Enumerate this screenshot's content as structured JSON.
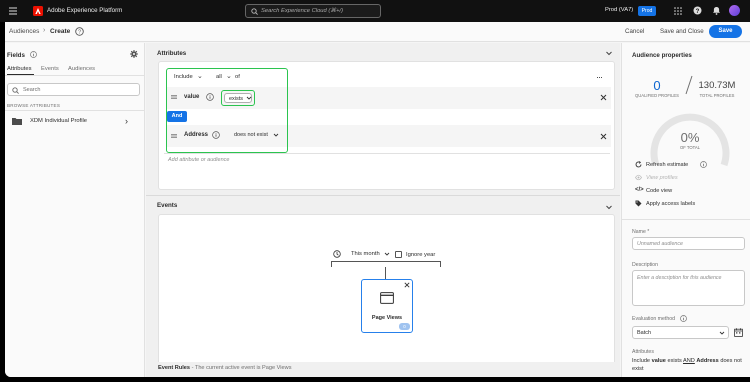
{
  "topbar": {
    "product": "Adobe Experience Platform",
    "search_placeholder": "Search Experience Cloud (⌘+/)",
    "org": "Prod (VA7)",
    "env_badge": "Prod"
  },
  "header": {
    "breadcrumb_parent": "Audiences",
    "breadcrumb_current": "Create",
    "cancel": "Cancel",
    "save_close": "Save and Close",
    "save": "Save"
  },
  "fields": {
    "title": "Fields",
    "tabs": [
      "Attributes",
      "Events",
      "Audiences"
    ],
    "search_placeholder": "Search",
    "browse_label": "BROWSE ATTRIBUTES",
    "item": "XDM Individual Profile"
  },
  "attributes": {
    "title": "Attributes",
    "include": "Include",
    "all": "all",
    "of": "of",
    "rule1_field": "value",
    "rule1_op": "exists",
    "and": "And",
    "rule2_field": "Address",
    "rule2_op": "does not exist",
    "add_placeholder": "Add attribute or audience"
  },
  "events": {
    "title": "Events",
    "time_range": "This month",
    "ignore_year": "Ignore year",
    "card_label": "Page Views",
    "card_badge": "0",
    "footer_title": "Event Rules",
    "footer_text": " - The current active event is Page Views"
  },
  "properties": {
    "title": "Audience properties",
    "qualified_value": "0",
    "qualified_label": "QUALIFIED PROFILES",
    "total_value": "130.73M",
    "total_label": "TOTAL PROFILES",
    "percent": "0%",
    "percent_label": "OF TOTAL",
    "refresh": "Refresh estimate",
    "view_profiles": "View profiles",
    "code_view": "Code view",
    "access_labels": "Apply access labels",
    "name_label": "Name *",
    "name_placeholder": "Unnamed audience",
    "desc_label": "Description",
    "desc_placeholder": "Enter a description for this audience",
    "eval_label": "Evaluation method",
    "eval_value": "Batch",
    "attr_label": "Attributes",
    "summary_1": "Include ",
    "summary_value": "value",
    "summary_2": " exists ",
    "summary_and": "AND",
    "summary_3": " ",
    "summary_address": "Address",
    "summary_4": " does not",
    "summary_5": "exist"
  },
  "colors": {
    "accent": "#1473e6",
    "highlight": "#2bc44f",
    "topbar": "#111111",
    "brand": "#eb1000"
  }
}
